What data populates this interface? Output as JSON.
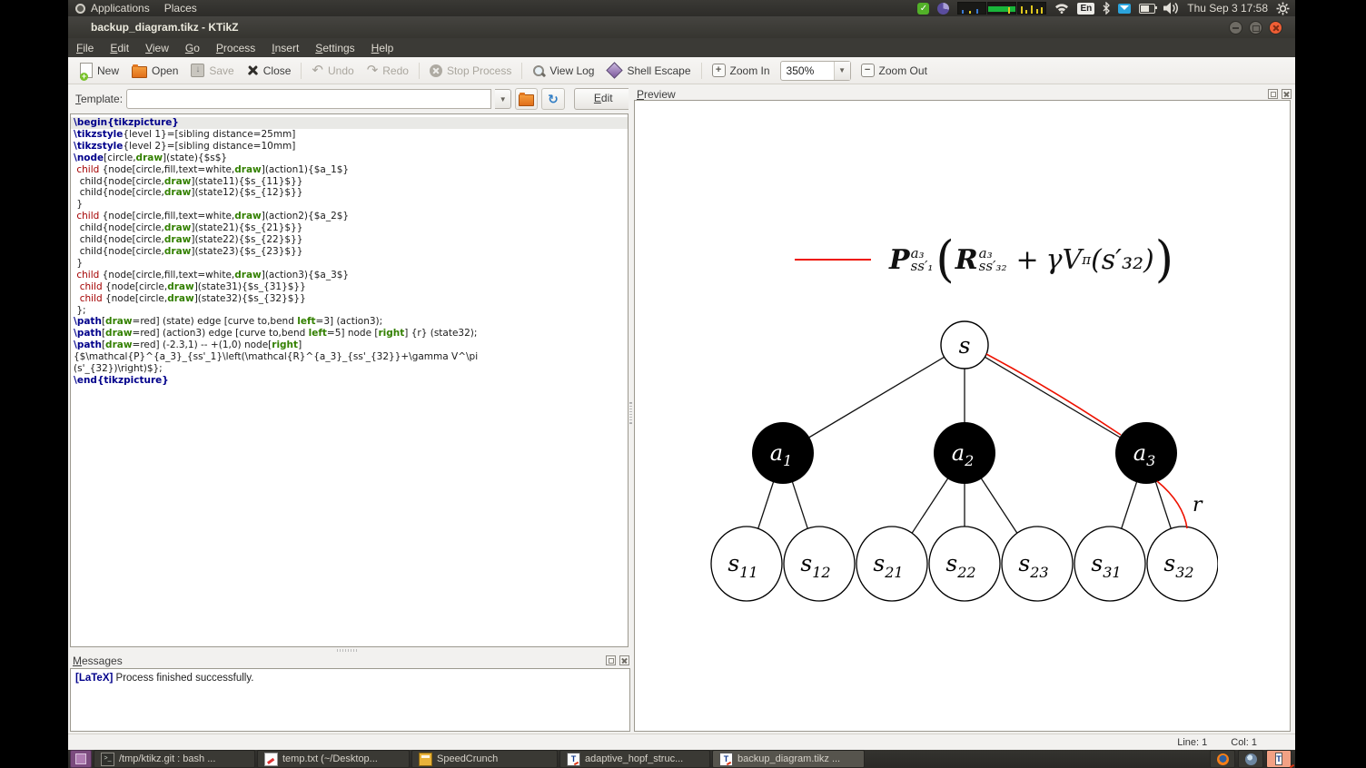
{
  "desktop": {
    "apps_menu": "Applications",
    "places_menu": "Places",
    "keyboard_indicator": "En",
    "clock": "Thu Sep 3 17:58"
  },
  "window": {
    "title": "backup_diagram.tikz - KTikZ",
    "menu": [
      "File",
      "Edit",
      "View",
      "Go",
      "Process",
      "Insert",
      "Settings",
      "Help"
    ],
    "toolbar": {
      "buttons": [
        {
          "label": "New",
          "enabled": true
        },
        {
          "label": "Open",
          "enabled": true
        },
        {
          "label": "Save",
          "enabled": false
        },
        {
          "label": "Close",
          "enabled": true
        },
        {
          "label": "Undo",
          "enabled": false
        },
        {
          "label": "Redo",
          "enabled": false
        },
        {
          "label": "Stop Process",
          "enabled": false
        },
        {
          "label": "View Log",
          "enabled": true
        },
        {
          "label": "Shell Escape",
          "enabled": true
        },
        {
          "label": "Zoom In",
          "enabled": true
        },
        {
          "label": "Zoom Out",
          "enabled": true
        }
      ],
      "zoom_value": "350%"
    },
    "template": {
      "label": "Template:",
      "value": "",
      "edit_button": "Edit"
    },
    "editor": {
      "current_line": 0,
      "lines": [
        [
          [
            "k",
            "\\begin{tikzpicture}"
          ]
        ],
        [
          [
            "k",
            "\\tikzstyle"
          ],
          [
            "p",
            "{level 1}=[sibling distance=25mm]"
          ]
        ],
        [
          [
            "k",
            "\\tikzstyle"
          ],
          [
            "p",
            "{level 2}=[sibling distance=10mm]"
          ]
        ],
        [
          [
            "k",
            "\\node"
          ],
          [
            "p",
            "[circle,"
          ],
          [
            "g",
            "draw"
          ],
          [
            "p",
            "](state){$s$}"
          ]
        ],
        [
          [
            "p",
            " "
          ],
          [
            "c",
            "child"
          ],
          [
            "p",
            " {node[circle,fill,text=white,"
          ],
          [
            "g",
            "draw"
          ],
          [
            "p",
            "](action1){$a_1$}"
          ]
        ],
        [
          [
            "p",
            "  child{node[circle,"
          ],
          [
            "g",
            "draw"
          ],
          [
            "p",
            "](state11){$s_{11}$}}"
          ]
        ],
        [
          [
            "p",
            "  child{node[circle,"
          ],
          [
            "g",
            "draw"
          ],
          [
            "p",
            "](state12){$s_{12}$}}"
          ]
        ],
        [
          [
            "p",
            " }"
          ]
        ],
        [
          [
            "p",
            " "
          ],
          [
            "c",
            "child"
          ],
          [
            "p",
            " {node[circle,fill,text=white,"
          ],
          [
            "g",
            "draw"
          ],
          [
            "p",
            "](action2){$a_2$}"
          ]
        ],
        [
          [
            "p",
            "  child{node[circle,"
          ],
          [
            "g",
            "draw"
          ],
          [
            "p",
            "](state21){$s_{21}$}}"
          ]
        ],
        [
          [
            "p",
            "  child{node[circle,"
          ],
          [
            "g",
            "draw"
          ],
          [
            "p",
            "](state22){$s_{22}$}}"
          ]
        ],
        [
          [
            "p",
            "  child{node[circle,"
          ],
          [
            "g",
            "draw"
          ],
          [
            "p",
            "](state23){$s_{23}$}}"
          ]
        ],
        [
          [
            "p",
            " }"
          ]
        ],
        [
          [
            "p",
            " "
          ],
          [
            "c",
            "child"
          ],
          [
            "p",
            " {node[circle,fill,text=white,"
          ],
          [
            "g",
            "draw"
          ],
          [
            "p",
            "](action3){$a_3$}"
          ]
        ],
        [
          [
            "p",
            "  "
          ],
          [
            "c",
            "child"
          ],
          [
            "p",
            " {node[circle,"
          ],
          [
            "g",
            "draw"
          ],
          [
            "p",
            "](state31){$s_{31}$}}"
          ]
        ],
        [
          [
            "p",
            "  "
          ],
          [
            "c",
            "child"
          ],
          [
            "p",
            " {node[circle,"
          ],
          [
            "g",
            "draw"
          ],
          [
            "p",
            "](state32){$s_{32}$}}"
          ]
        ],
        [
          [
            "p",
            " };"
          ]
        ],
        [
          [
            "k",
            "\\path"
          ],
          [
            "p",
            "["
          ],
          [
            "g",
            "draw"
          ],
          [
            "p",
            "=red] (state) edge [curve to,bend "
          ],
          [
            "g",
            "left"
          ],
          [
            "p",
            "=3] (action3);"
          ]
        ],
        [
          [
            "k",
            "\\path"
          ],
          [
            "p",
            "["
          ],
          [
            "g",
            "draw"
          ],
          [
            "p",
            "=red] (action3) edge [curve to,bend "
          ],
          [
            "g",
            "left"
          ],
          [
            "p",
            "=5] node ["
          ],
          [
            "g",
            "right"
          ],
          [
            "p",
            "] {r} (state32);"
          ]
        ],
        [
          [
            "k",
            "\\path"
          ],
          [
            "p",
            "["
          ],
          [
            "g",
            "draw"
          ],
          [
            "p",
            "=red] (-2.3,1) -- +(1,0) node["
          ],
          [
            "g",
            "right"
          ],
          [
            "p",
            "] {$\\mathcal{P}^{a_3}_{ss'_1}\\left(\\mathcal{R}^{a_3}_{ss'_{32}}+\\gamma V^\\pi"
          ]
        ],
        [
          [
            "p",
            "(s'_{32})\\right)$};"
          ]
        ],
        [
          [
            "k",
            "\\end{tikzpicture}"
          ]
        ]
      ]
    },
    "messages": {
      "title": "Messages",
      "log_tag": "[LaTeX]",
      "log_text": " Process finished successfully."
    },
    "preview": {
      "title": "Preview",
      "formula": {
        "P": "P",
        "P_sup": "a₃",
        "P_sub": "ss′₁",
        "open_paren": "(",
        "R": "R",
        "R_sup": "a₃",
        "R_sub": "ss′₃₂",
        "plus": "+",
        "gammaV": "γV",
        "gammaV_sup": "π",
        "arg": "(s′₃₂)",
        "close_paren": ")"
      },
      "diagram": {
        "root": {
          "base": "s"
        },
        "actions": [
          {
            "base": "a",
            "sub": "1"
          },
          {
            "base": "a",
            "sub": "2"
          },
          {
            "base": "a",
            "sub": "3"
          }
        ],
        "states": [
          {
            "base": "s",
            "sub": "11"
          },
          {
            "base": "s",
            "sub": "12"
          },
          {
            "base": "s",
            "sub": "21"
          },
          {
            "base": "s",
            "sub": "22"
          },
          {
            "base": "s",
            "sub": "23"
          },
          {
            "base": "s",
            "sub": "31"
          },
          {
            "base": "s",
            "sub": "32"
          }
        ],
        "reward_label": "r",
        "colors": {
          "edge": "#111111",
          "highlight_red": "#ee1100",
          "action_fill": "#000000"
        }
      }
    },
    "statusbar": {
      "line": "Line: 1",
      "col": "Col: 1"
    }
  },
  "taskbar": {
    "tasks": [
      {
        "label": "/tmp/ktikz.git : bash ...",
        "active": false
      },
      {
        "label": "temp.txt (~/Desktop...",
        "active": false
      },
      {
        "label": "SpeedCrunch",
        "active": false
      },
      {
        "label": "adaptive_hopf_struc...",
        "active": false
      },
      {
        "label": "backup_diagram.tikz ...",
        "active": true
      }
    ]
  }
}
